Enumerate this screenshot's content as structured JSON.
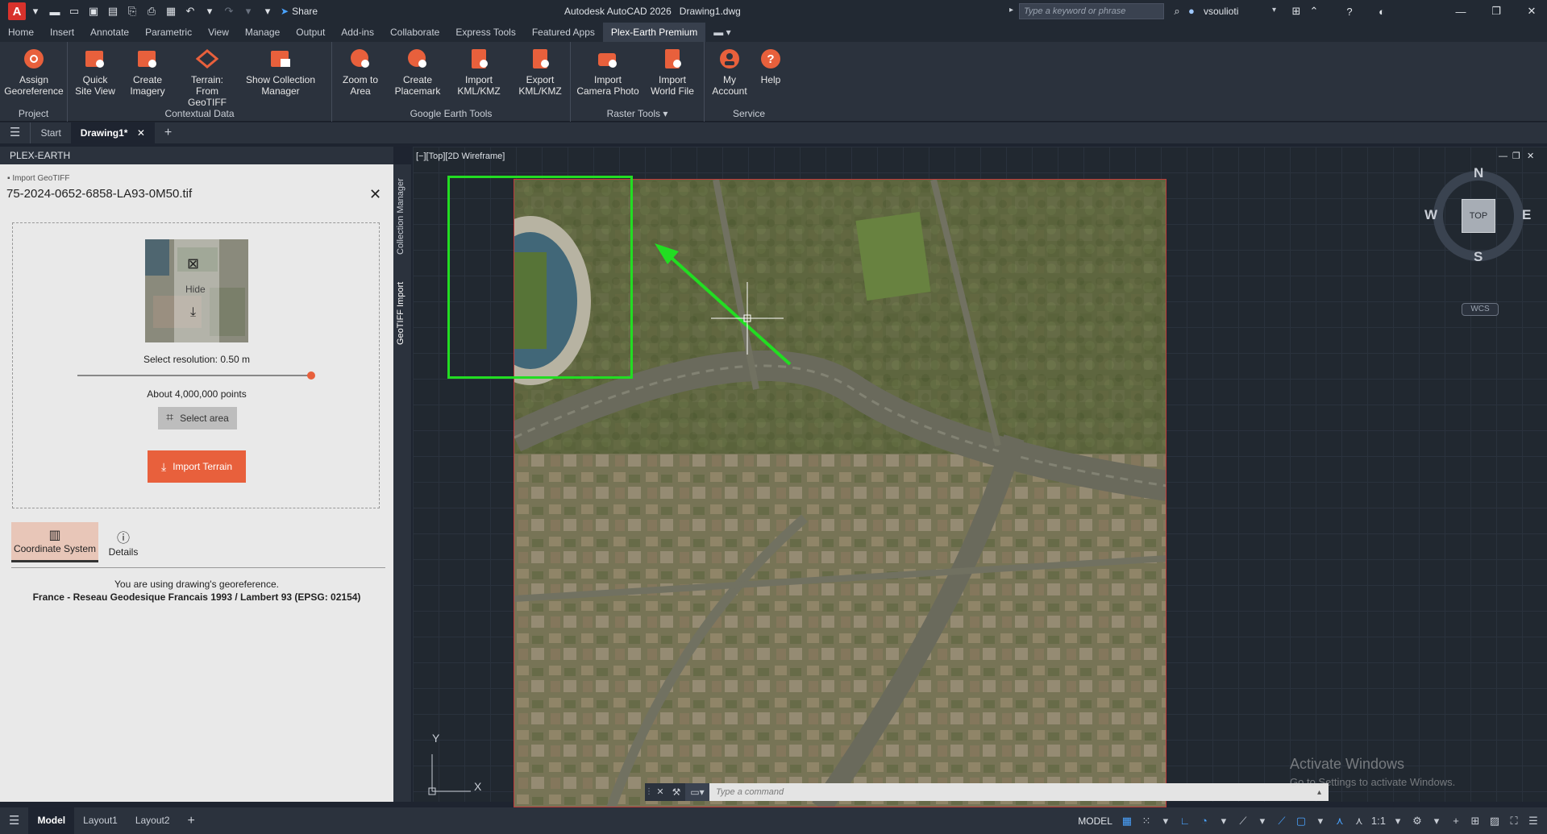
{
  "app": {
    "logo_letter": "A",
    "title": "Autodesk AutoCAD 2026",
    "filename": "Drawing1.dwg",
    "share": "Share",
    "search_placeholder": "Type a keyword or phrase",
    "user": "vsoulioti"
  },
  "menu": {
    "tabs": [
      "Home",
      "Insert",
      "Annotate",
      "Parametric",
      "View",
      "Manage",
      "Output",
      "Add-ins",
      "Collaborate",
      "Express Tools",
      "Featured Apps",
      "Plex-Earth Premium"
    ],
    "active": "Plex-Earth Premium"
  },
  "ribbon": {
    "groups": {
      "project": "Project",
      "contextual": "Contextual Data",
      "google": "Google Earth Tools",
      "raster": "Raster Tools",
      "service": "Service"
    },
    "buttons": {
      "assign_georef_1": "Assign",
      "assign_georef_2": "Georeference",
      "quick_site_1": "Quick",
      "quick_site_2": "Site View",
      "create_imagery_1": "Create",
      "create_imagery_2": "Imagery",
      "terrain_1": "Terrain:",
      "terrain_2": "From GeoTIFF",
      "show_coll_1": "Show Collection",
      "show_coll_2": "Manager",
      "zoom_area_1": "Zoom to",
      "zoom_area_2": "Area",
      "create_placemark_1": "Create",
      "create_placemark_2": "Placemark",
      "import_kml_1": "Import",
      "import_kml_2": "KML/KMZ",
      "export_kml_1": "Export",
      "export_kml_2": "KML/KMZ",
      "import_camera_1": "Import",
      "import_camera_2": "Camera Photo",
      "import_world_1": "Import",
      "import_world_2": "World File",
      "my_account_1": "My",
      "my_account_2": "Account",
      "help": "Help"
    }
  },
  "doc_tabs": {
    "start": "Start",
    "drawing": "Drawing1*"
  },
  "panel": {
    "header": "PLEX-EARTH",
    "section_label": "Import GeoTIFF",
    "file_name": "75-2024-0652-6858-LA93-0M50.tif",
    "hide_label": "Hide",
    "resolution_label": "Select resolution: 0.50 m",
    "resolution_fraction": 1.0,
    "points_label": "About 4,000,000 points",
    "select_area": "Select area",
    "import_terrain": "Import Terrain",
    "tab_coord": "Coordinate System",
    "tab_details": "Details",
    "georef_note": "You are using drawing's georeference.",
    "crs": "France - Reseau Geodesique Francais 1993 / Lambert 93 (EPSG: 02154)",
    "side_tab_1": "Collection Manager",
    "side_tab_2": "GeoTIFF Import"
  },
  "viewport": {
    "label": "[−][Top][2D Wireframe]",
    "compass": {
      "n": "N",
      "s": "S",
      "e": "E",
      "w": "W",
      "top": "TOP",
      "wcs": "WCS"
    },
    "axis_y": "Y",
    "axis_x": "X",
    "command_placeholder": "Type  a  command",
    "watermark_1": "Activate Windows",
    "watermark_2": "Go to Settings to activate Windows."
  },
  "status": {
    "layouts": [
      "Model",
      "Layout1",
      "Layout2"
    ],
    "model_label": "MODEL",
    "scale": "1:1"
  },
  "colors": {
    "accent_orange": "#e8603c",
    "highlight_green": "#22dd22",
    "active_blue": "#4aa3ff"
  }
}
